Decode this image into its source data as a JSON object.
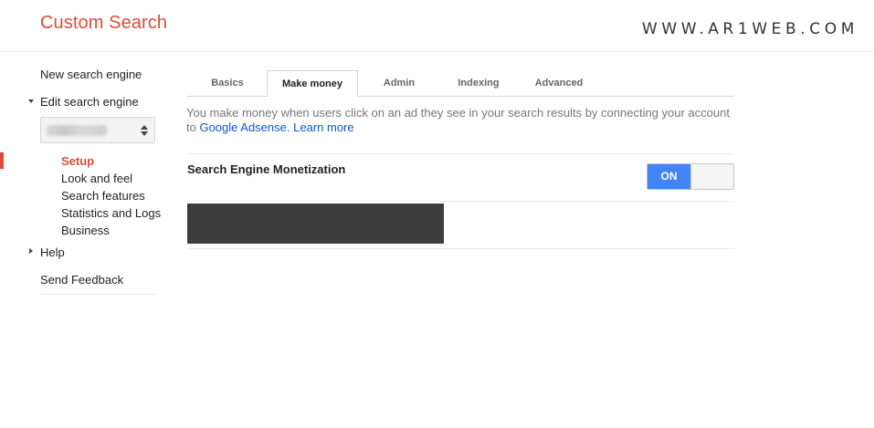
{
  "header": {
    "app_title": "Custom Search",
    "watermark": "WWW.AR1WEB.COM"
  },
  "sidebar": {
    "new_engine": "New search engine",
    "edit_engine": "Edit search engine",
    "engine_select_value": "",
    "sub_items": [
      {
        "label": "Setup",
        "active": true
      },
      {
        "label": "Look and feel",
        "active": false
      },
      {
        "label": "Search features",
        "active": false
      },
      {
        "label": "Statistics and Logs",
        "active": false
      },
      {
        "label": "Business",
        "active": false
      }
    ],
    "help": "Help",
    "send_feedback": "Send Feedback"
  },
  "tabs": [
    {
      "label": "Basics",
      "selected": false
    },
    {
      "label": "Make money",
      "selected": true
    },
    {
      "label": "Admin",
      "selected": false
    },
    {
      "label": "Indexing",
      "selected": false
    },
    {
      "label": "Advanced",
      "selected": false
    }
  ],
  "main": {
    "description_prefix": "You make money when users click on an ad they see in your search results by connecting your account to ",
    "adsense_link": "Google Adsense.",
    "learn_more_link": "Learn more",
    "monetization_label": "Search Engine Monetization",
    "toggle_state": "ON"
  },
  "colors": {
    "brand_red": "#dd4b39",
    "toggle_blue": "#4285f4",
    "link_blue": "#1155cc",
    "redacted_block": "#3d3d3d"
  }
}
